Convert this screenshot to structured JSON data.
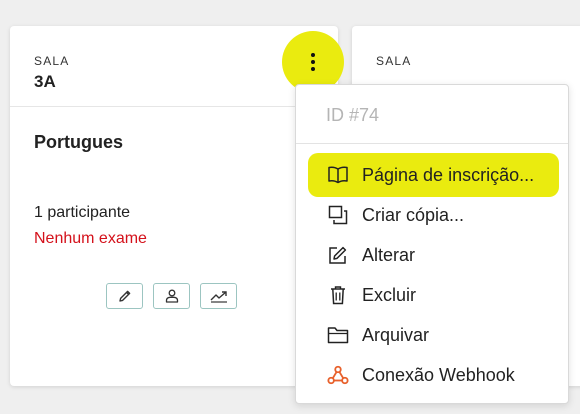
{
  "cards": [
    {
      "sala_label": "SALA",
      "sala_code": "3A",
      "course": "Portugues",
      "participants": "1 participante",
      "exams_status": "Nenhum exame",
      "exams_status_color": "#d4111b",
      "actions": [
        {
          "icon": "pencil-icon"
        },
        {
          "icon": "user-icon"
        },
        {
          "icon": "trend-chart-icon"
        }
      ]
    },
    {
      "sala_label": "SALA"
    }
  ],
  "kebab_highlight_color": "#eaeb0f",
  "menu": {
    "id_label": "ID #74",
    "items": [
      {
        "label": "Página de inscrição...",
        "icon": "book-icon",
        "highlighted": true
      },
      {
        "label": "Criar cópia...",
        "icon": "copy-icon"
      },
      {
        "label": "Alterar",
        "icon": "edit-icon"
      },
      {
        "label": "Excluir",
        "icon": "trash-icon"
      },
      {
        "label": "Arquivar",
        "icon": "folder-icon"
      },
      {
        "label": "Conexão Webhook",
        "icon": "webhook-icon",
        "icon_color": "#e8612c"
      }
    ]
  }
}
